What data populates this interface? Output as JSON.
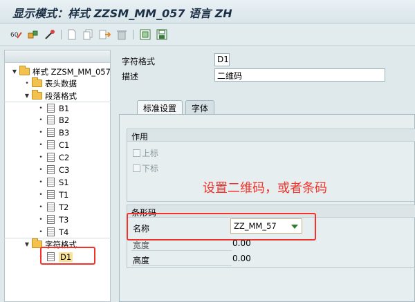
{
  "title": "显示模式：样式 ZZSM_MM_057 语言 ZH",
  "toolbar": {
    "icons": [
      "display-change-icon",
      "activate-icon",
      "wand-icon",
      "new-icon",
      "copy-icon",
      "transfer-icon",
      "delete-icon",
      "frame-icon",
      "save-icon"
    ]
  },
  "tree": {
    "root": "样式 ZZSM_MM_057",
    "header_data": "表头数据",
    "paragraph_formats": "段落格式",
    "paragraphs": [
      "B1",
      "B2",
      "B3",
      "C1",
      "C2",
      "C3",
      "S1",
      "T1",
      "T2",
      "T3",
      "T4"
    ],
    "char_formats": "字符格式",
    "chars": [
      "D1"
    ]
  },
  "form": {
    "char_format_label": "字符格式",
    "char_format_value": "D1",
    "desc_label": "描述",
    "desc_value": "二维码"
  },
  "tabs": {
    "standard": "标准设置",
    "font": "字体"
  },
  "usage": {
    "title": "作用",
    "superscript": "上标",
    "subscript": "下标"
  },
  "annotation": "设置二维码，或者条码",
  "barcode": {
    "title": "条形码",
    "name_label": "名称",
    "name_value": "ZZ_MM_57",
    "width_label": "宽度",
    "width_value": "0.00",
    "height_label": "高度",
    "height_value": "0.00"
  },
  "colors": {
    "highlight": "#f0322a",
    "selected_tab": "#f3f7f8"
  }
}
